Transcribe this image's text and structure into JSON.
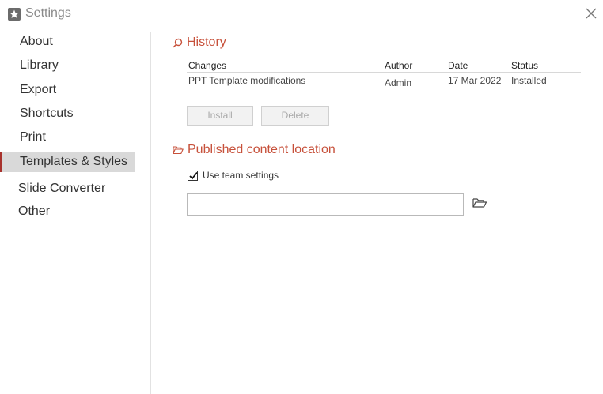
{
  "window": {
    "title": "Settings",
    "app_icon": "app-star-icon",
    "close_icon": "close-icon"
  },
  "sidebar": {
    "items": [
      {
        "label": "About",
        "active": false
      },
      {
        "label": "Library",
        "active": false
      },
      {
        "label": "Export",
        "active": false
      },
      {
        "label": "Shortcuts",
        "active": false
      },
      {
        "label": "Print",
        "active": false
      },
      {
        "label": "Templates & Styles",
        "active": true
      },
      {
        "label": "Slide Converter",
        "active": false
      },
      {
        "label": "Other",
        "active": false
      }
    ]
  },
  "history": {
    "title": "History",
    "icon": "search-icon",
    "columns": [
      "Changes",
      "Author",
      "Date",
      "Status"
    ],
    "rows": [
      [
        "PPT Template modifications",
        "Admin",
        "17 Mar 2022",
        "Installed"
      ]
    ],
    "install_label": "Install",
    "delete_label": "Delete"
  },
  "published": {
    "title": "Published content location",
    "icon": "folder-open-icon",
    "use_team_settings_label": "Use team settings",
    "use_team_settings_checked": true,
    "path_value": "",
    "browse_icon": "folder-open-icon"
  },
  "colors": {
    "accent": "#c7513b",
    "active_marker": "#a8322d",
    "active_bg": "#d9d9d9"
  }
}
